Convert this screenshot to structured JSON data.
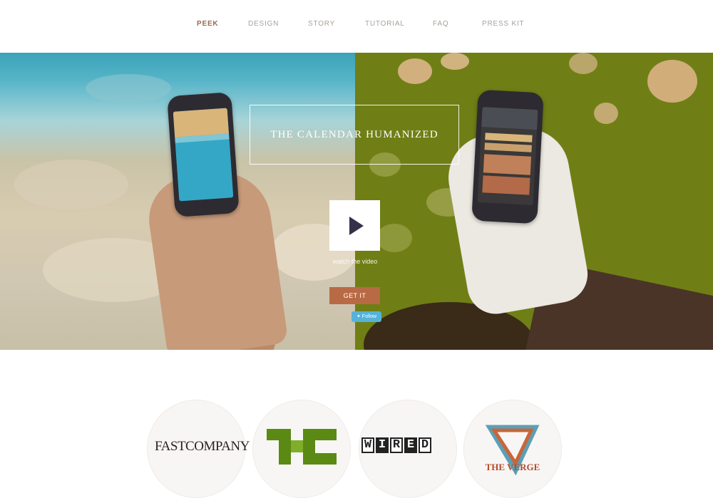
{
  "nav": {
    "items": [
      {
        "label": "PEEK",
        "active": true
      },
      {
        "label": "DESIGN",
        "active": false
      },
      {
        "label": "STORY",
        "active": false
      },
      {
        "label": "TUTORIAL",
        "active": false
      },
      {
        "label": "FAQ",
        "active": false
      },
      {
        "label": "PRESS KIT",
        "active": false
      }
    ]
  },
  "hero": {
    "headline": "THE CALENDAR HUMANIZED",
    "play_icon": "play-icon",
    "watch_label": "watch the video",
    "get_label": "GET IT",
    "follow_label": "Follow",
    "follow_icon": "twitter-bird-icon"
  },
  "press": {
    "logos": [
      {
        "name": "FAST COMPANY",
        "text": "FASTCOMPANY"
      },
      {
        "name": "TechCrunch",
        "text": ""
      },
      {
        "name": "WIRED",
        "text": "WIRED"
      },
      {
        "name": "THE VERGE",
        "text": "THE VERGE"
      }
    ]
  },
  "colors": {
    "accent": "#b86a45",
    "nav_active": "#9a6a4e",
    "nav_inactive": "#a8a19a",
    "twitter": "#54b3d9",
    "techcrunch_green": "#5a8a14",
    "verge_orange": "#b34a2a"
  }
}
